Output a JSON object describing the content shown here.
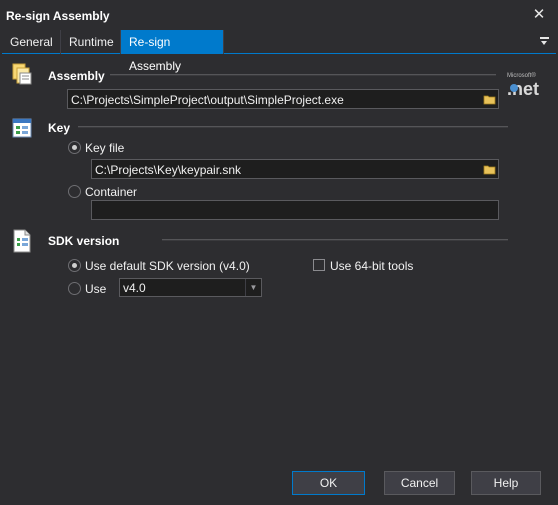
{
  "window": {
    "title": "Re-sign Assembly"
  },
  "tabs": [
    {
      "label": "General"
    },
    {
      "label": "Runtime"
    },
    {
      "label": "Re-sign Assembly"
    }
  ],
  "assembly": {
    "heading": "Assembly",
    "path": "C:\\Projects\\SimpleProject\\output\\SimpleProject.exe"
  },
  "key": {
    "heading": "Key",
    "key_file_label": "Key file",
    "key_file_value": "C:\\Projects\\Key\\keypair.snk",
    "key_file_selected": true,
    "container_label": "Container",
    "container_value": ""
  },
  "sdk": {
    "heading": "SDK version",
    "default_label": "Use default SDK version (v4.0)",
    "default_selected": true,
    "use_label": "Use",
    "version_value": "v4.0",
    "x64_label": "Use 64-bit tools",
    "x64_checked": false
  },
  "buttons": {
    "ok": "OK",
    "cancel": "Cancel",
    "help": "Help"
  },
  "colors": {
    "accent": "#007acc",
    "background": "#2d2d30",
    "field": "#1e1e1e"
  }
}
